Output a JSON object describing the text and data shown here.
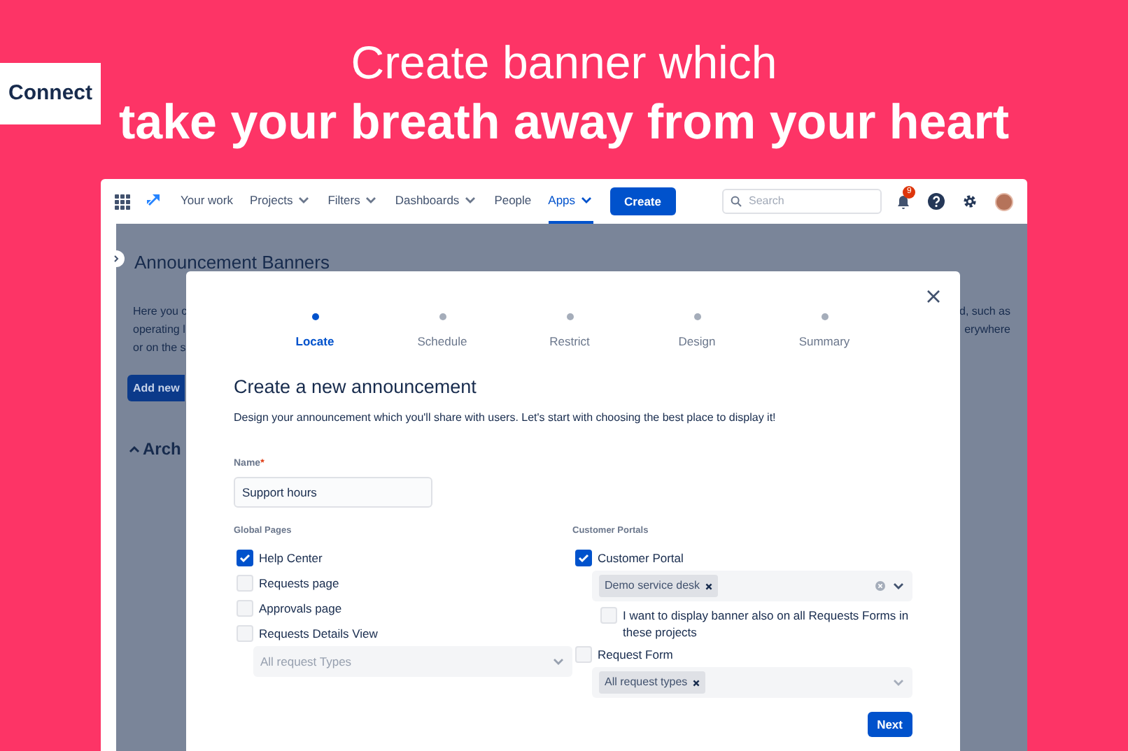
{
  "badge": "Connect",
  "headline": {
    "line_1": "Create banner which",
    "line_2": "take your breath away from your heart"
  },
  "nav": {
    "items": [
      {
        "label": "Your work",
        "dropdown": false,
        "selected": false
      },
      {
        "label": "Projects",
        "dropdown": true,
        "selected": false
      },
      {
        "label": "Filters",
        "dropdown": true,
        "selected": false
      },
      {
        "label": "Dashboards",
        "dropdown": true,
        "selected": false
      },
      {
        "label": "People",
        "dropdown": false,
        "selected": false
      },
      {
        "label": "Apps",
        "dropdown": true,
        "selected": true
      }
    ],
    "create_button": "Create",
    "search": {
      "placeholder": "Search"
    },
    "notification_count": "9"
  },
  "background_page": {
    "title": "Announcement Banners",
    "left_fragments": [
      "Here you c",
      "operating l",
      "or on the s"
    ],
    "right_fragments": [
      "d, such as",
      "erywhere"
    ],
    "button": "Add new",
    "section": "Arch"
  },
  "modal": {
    "steps": [
      {
        "label": "Locate",
        "selected": true
      },
      {
        "label": "Schedule",
        "selected": false
      },
      {
        "label": "Restrict",
        "selected": false
      },
      {
        "label": "Design",
        "selected": false
      },
      {
        "label": "Summary",
        "selected": false
      }
    ],
    "title": "Create a new announcement",
    "description": "Design your announcement which you'll share with users. Let's start with choosing the best place to display it!",
    "name_field": {
      "label": "Name",
      "required_mark": "*",
      "value": "Support hours"
    },
    "global_pages": {
      "heading": "Global Pages",
      "options": [
        {
          "label": "Help Center",
          "checked": true
        },
        {
          "label": "Requests page",
          "checked": false
        },
        {
          "label": "Approvals page",
          "checked": false
        },
        {
          "label": "Requests Details View",
          "checked": false
        }
      ],
      "select": {
        "placeholder": "All request Types"
      }
    },
    "customer_portals": {
      "heading": "Customer Portals",
      "customer_portal": {
        "label": "Customer Portal",
        "checked": true,
        "tag": "Demo service desk",
        "sub_option": {
          "label": "I want to display banner also on all Requests Forms in these projects",
          "checked": false
        }
      },
      "request_form": {
        "label": "Request Form",
        "checked": false,
        "tag": "All request types"
      }
    },
    "next_button": "Next"
  }
}
